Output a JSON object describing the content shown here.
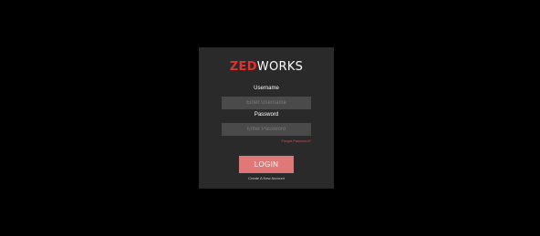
{
  "brand": {
    "logo_part_1": "ZED",
    "logo_part_2": "WORKS",
    "accent_color": "#e03030"
  },
  "login_form": {
    "username_label": "Username",
    "username_placeholder": "Enter Username",
    "username_value": "",
    "password_label": "Password",
    "password_placeholder": "Enter Password",
    "password_value": "",
    "forgot_password_link": "Forgot Password?",
    "login_button_label": "LOGIN",
    "create_account_link": "Create A New Account"
  },
  "colors": {
    "page_background": "#000000",
    "card_background": "#2a2a2a",
    "input_background": "#4a4a4a",
    "button_background": "#e07878",
    "link_color": "#d05050"
  }
}
